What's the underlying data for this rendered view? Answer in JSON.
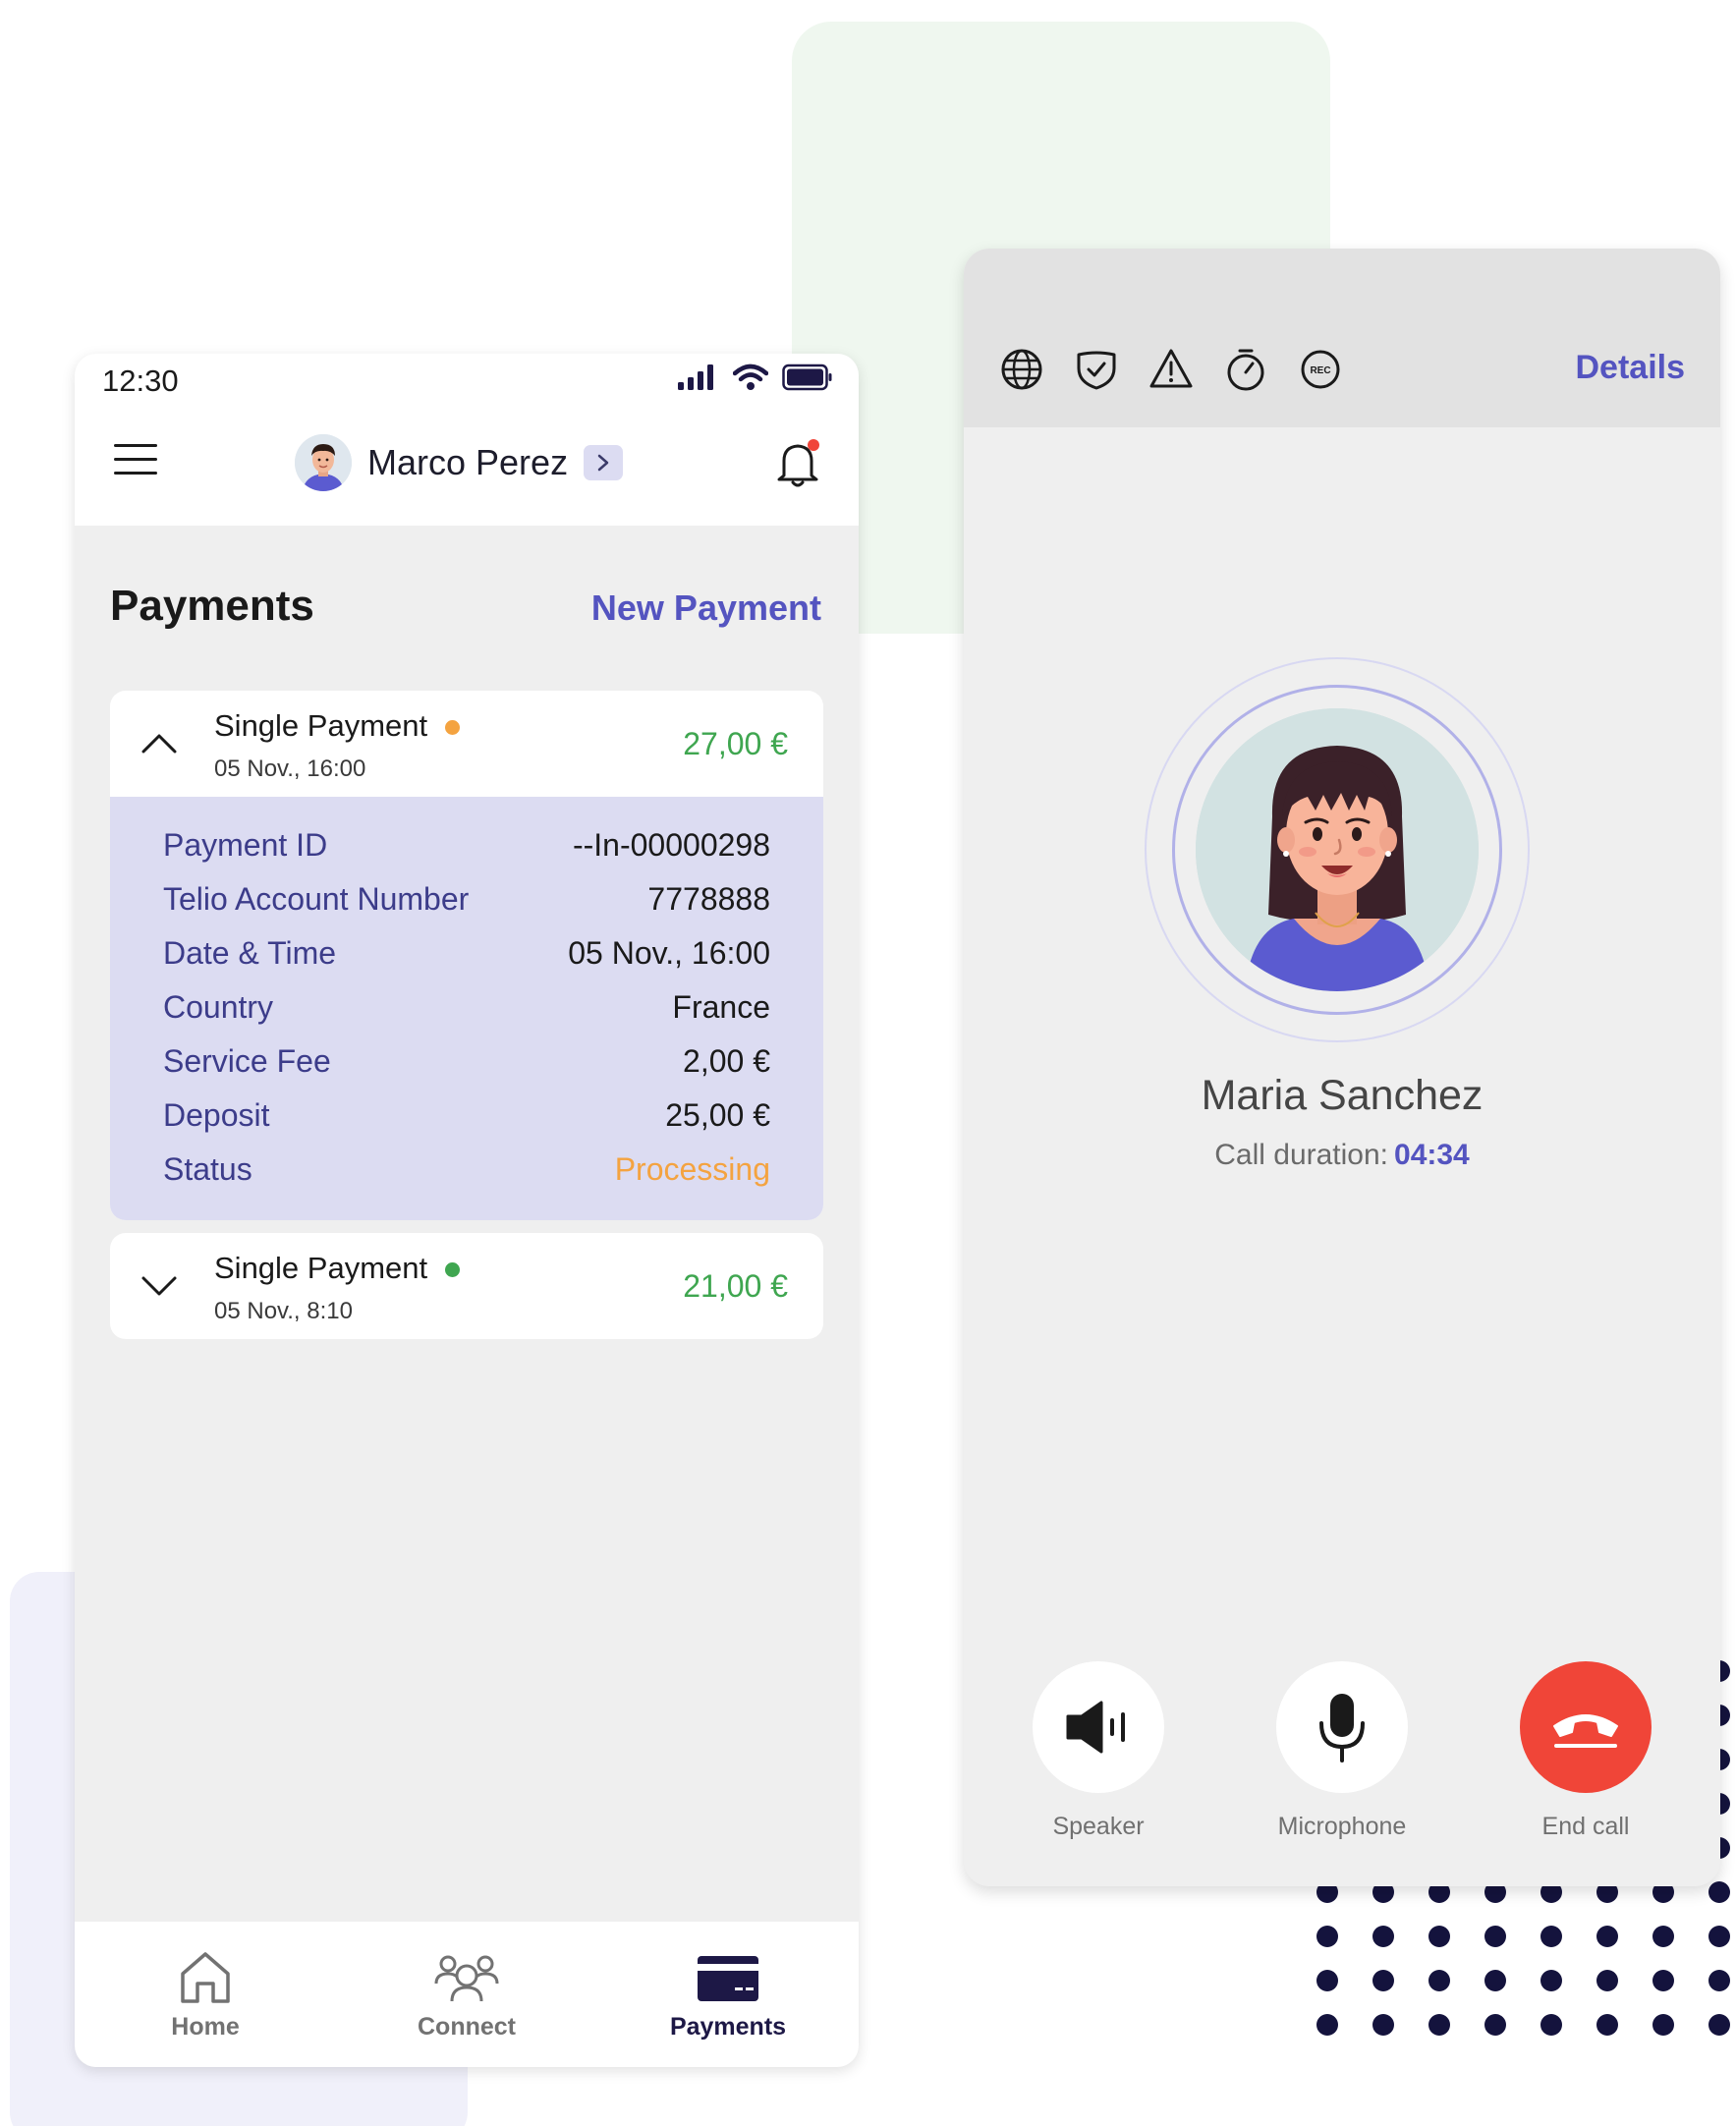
{
  "phone": {
    "status_time": "12:30",
    "user_name": "Marco Perez",
    "page_title": "Payments",
    "new_payment_label": "New Payment",
    "payments": [
      {
        "title": "Single Payment",
        "date": "05 Nov., 16:00",
        "amount": "27,00 €",
        "dot_color": "#f4a340",
        "expanded": true,
        "details": [
          {
            "label": "Payment ID",
            "value": "--In-00000298"
          },
          {
            "label": "Telio Account Number",
            "value": "7778888"
          },
          {
            "label": "Date & Time",
            "value": "05 Nov., 16:00"
          },
          {
            "label": "Country",
            "value": "France"
          },
          {
            "label": "Service Fee",
            "value": "2,00 €"
          },
          {
            "label": "Deposit",
            "value": "25,00 €"
          },
          {
            "label": "Status",
            "value": "Processing"
          }
        ]
      },
      {
        "title": "Single Payment",
        "date": "05 Nov., 8:10",
        "amount": "21,00 €",
        "dot_color": "#3fa650",
        "expanded": false
      }
    ],
    "tabs": [
      {
        "label": "Home",
        "icon": "home-icon"
      },
      {
        "label": "Connect",
        "icon": "people-icon"
      },
      {
        "label": "Payments",
        "icon": "card-icon",
        "active": true
      }
    ]
  },
  "call": {
    "details_label": "Details",
    "toolbar_icons": [
      "globe-icon",
      "shield-check-icon",
      "warning-icon",
      "timer-icon",
      "rec-icon"
    ],
    "rec_text": "REC",
    "callee_name": "Maria Sanchez",
    "duration_label": "Call duration:",
    "duration_value": "04:34",
    "controls": {
      "speaker": "Speaker",
      "microphone": "Microphone",
      "end_call": "End call"
    }
  },
  "colors": {
    "accent": "#5454c0",
    "amount_green": "#3fa650",
    "processing_orange": "#f4a340",
    "end_call_red": "#f04538",
    "details_bg": "#dcdcf2"
  }
}
